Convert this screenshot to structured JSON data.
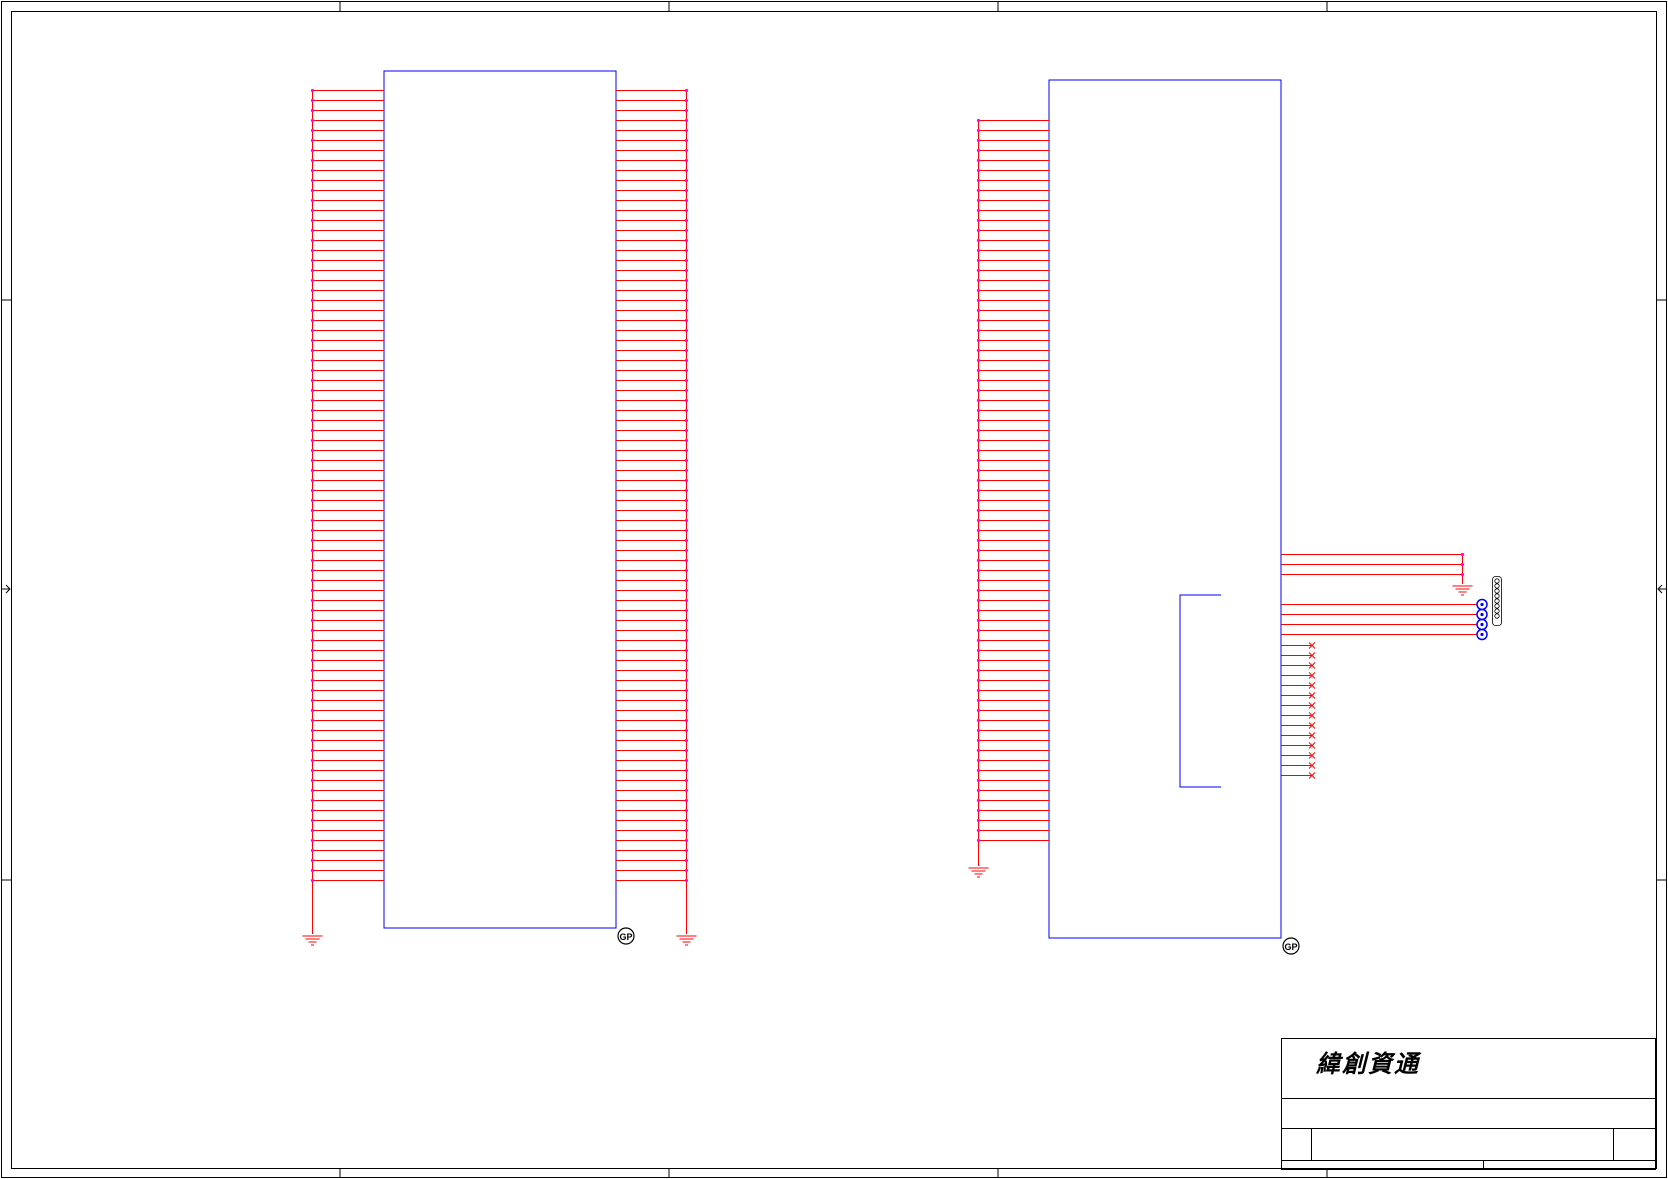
{
  "title_block": {
    "company": "緯創資通"
  },
  "markers": {
    "gp": "GP"
  },
  "colors": {
    "frame": "#000000",
    "wire": "#ff0000",
    "part_body": "#0000ff",
    "junction": "#ff00ff",
    "test_point": "#0000ff",
    "background": "#ffffff"
  },
  "connectors": [
    {
      "pin_rows": 80,
      "sides": "both",
      "ground_symbols": 2
    },
    {
      "pin_rows": 73,
      "sides": "left",
      "ground_symbols": 1
    }
  ],
  "right_side_nets": {
    "grounded_pins": 3,
    "test_points": 4,
    "no_connect_pins": 14
  },
  "icons": [
    "ground-icon",
    "gp-marker-icon",
    "test-point-icon",
    "no-connect-icon"
  ]
}
